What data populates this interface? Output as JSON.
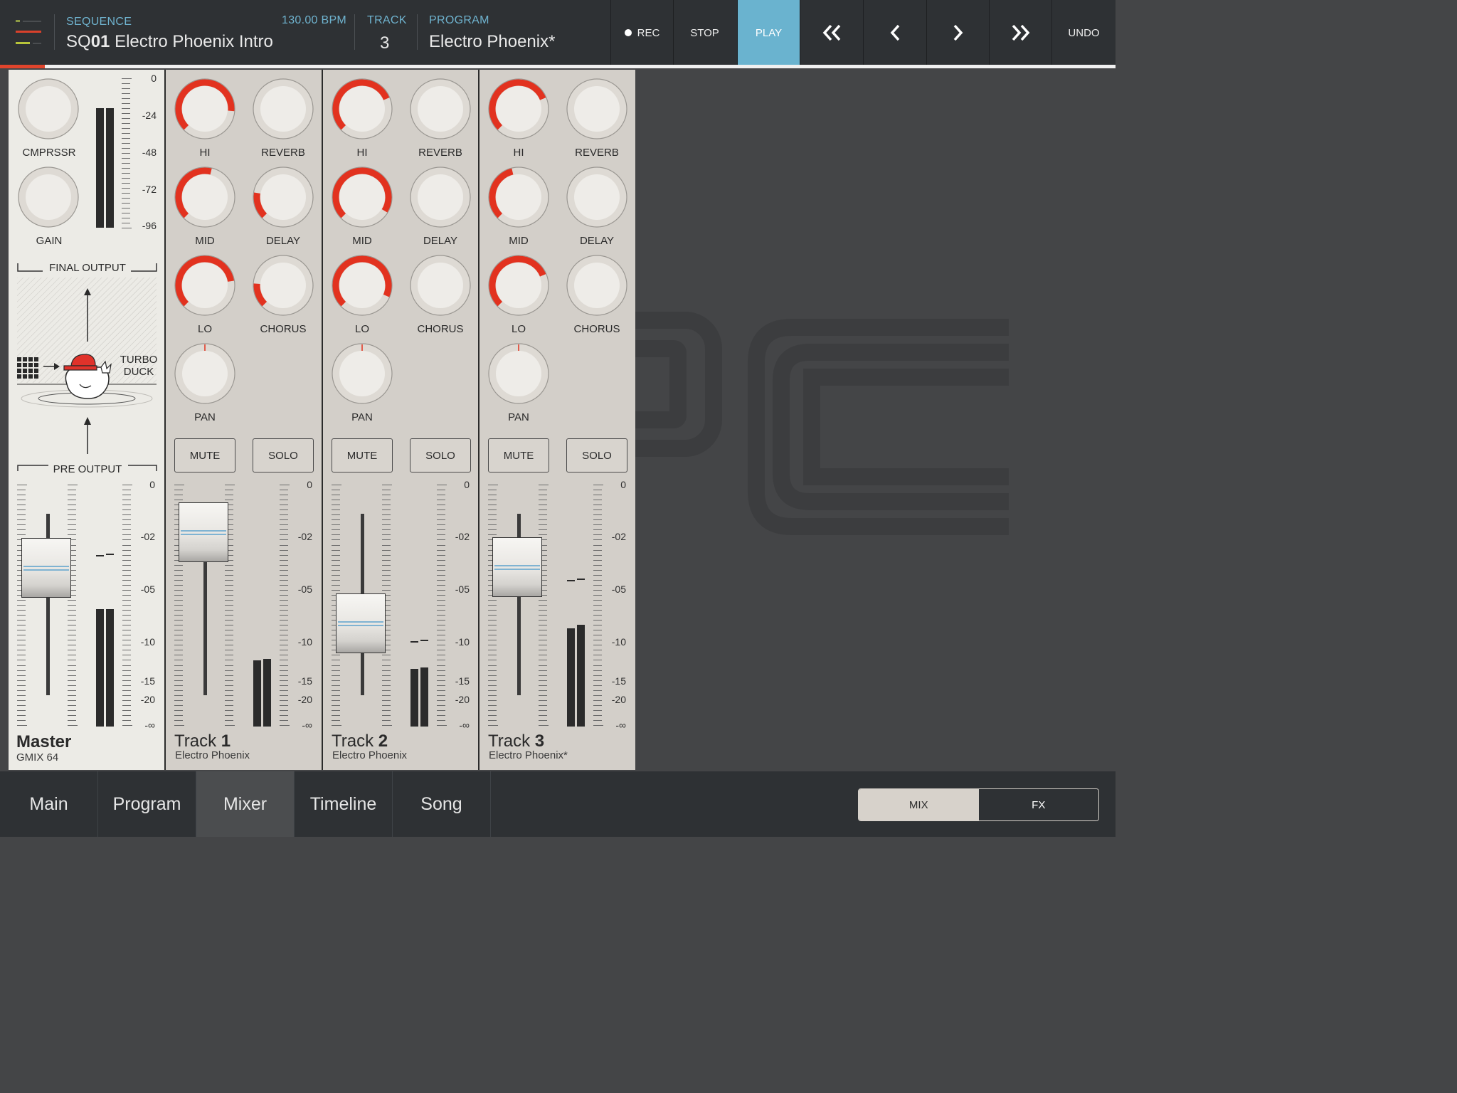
{
  "header": {
    "sequence_label": "SEQUENCE",
    "sequence_prefix": "SQ",
    "sequence_number": "01",
    "sequence_name": "Electro Phoenix Intro",
    "bpm": "130.00 BPM",
    "track_label": "TRACK",
    "track_value": "3",
    "program_label": "PROGRAM",
    "program_value": "Electro Phoenix*"
  },
  "transport": {
    "rec": "REC",
    "stop": "STOP",
    "play": "PLAY",
    "undo": "UNDO",
    "rewind_icon": "double-chevron-left-icon",
    "prev_icon": "chevron-left-icon",
    "next_icon": "chevron-right-icon",
    "ffwd_icon": "double-chevron-right-icon"
  },
  "sequence_progress": 0.04,
  "master": {
    "knobs": [
      "CMPRSSR",
      "GAIN"
    ],
    "top_meter_scale": [
      "0",
      "-24",
      "-48",
      "-72",
      "-96"
    ],
    "final_output": "FINAL OUTPUT",
    "turbo_duck": [
      "TURBO",
      "DUCK"
    ],
    "pre_output": "PRE OUTPUT",
    "name": "Master",
    "subtitle": "GMIX 64"
  },
  "fader_scale": [
    "0",
    "-02",
    "-05",
    "-10",
    "-15",
    "-20",
    "-∞"
  ],
  "tracks": [
    {
      "name": "Track",
      "number": "1",
      "subtitle": "Electro Phoenix",
      "knobs": [
        {
          "label": "HI",
          "level": 0.85
        },
        {
          "label": "REVERB",
          "level": 0
        },
        {
          "label": "MID",
          "level": 0.55
        },
        {
          "label": "DELAY",
          "level": 0.2
        },
        {
          "label": "LO",
          "level": 0.8
        },
        {
          "label": "CHORUS",
          "level": 0.18
        },
        {
          "label": "PAN",
          "level": 0.5
        }
      ],
      "mute": "MUTE",
      "solo": "SOLO"
    },
    {
      "name": "Track",
      "number": "2",
      "subtitle": "Electro Phoenix",
      "knobs": [
        {
          "label": "HI",
          "level": 0.75
        },
        {
          "label": "REVERB",
          "level": 0
        },
        {
          "label": "MID",
          "level": 0.95
        },
        {
          "label": "DELAY",
          "level": 0
        },
        {
          "label": "LO",
          "level": 0.92
        },
        {
          "label": "CHORUS",
          "level": 0
        },
        {
          "label": "PAN",
          "level": 0.5
        }
      ],
      "mute": "MUTE",
      "solo": "SOLO"
    },
    {
      "name": "Track",
      "number": "3",
      "subtitle": "Electro Phoenix*",
      "knobs": [
        {
          "label": "HI",
          "level": 0.75
        },
        {
          "label": "REVERB",
          "level": 0
        },
        {
          "label": "MID",
          "level": 0.45
        },
        {
          "label": "DELAY",
          "level": 0
        },
        {
          "label": "LO",
          "level": 0.75
        },
        {
          "label": "CHORUS",
          "level": 0
        },
        {
          "label": "PAN",
          "level": 0.5
        }
      ],
      "mute": "MUTE",
      "solo": "SOLO"
    }
  ],
  "nav": {
    "tabs": [
      "Main",
      "Program",
      "Mixer",
      "Timeline",
      "Song"
    ],
    "active_tab": "Mixer",
    "toggle": [
      "MIX",
      "FX"
    ],
    "active_toggle": "MIX"
  },
  "colors": {
    "accent": "#6ab3cf",
    "knob_red": "#e2321f"
  }
}
